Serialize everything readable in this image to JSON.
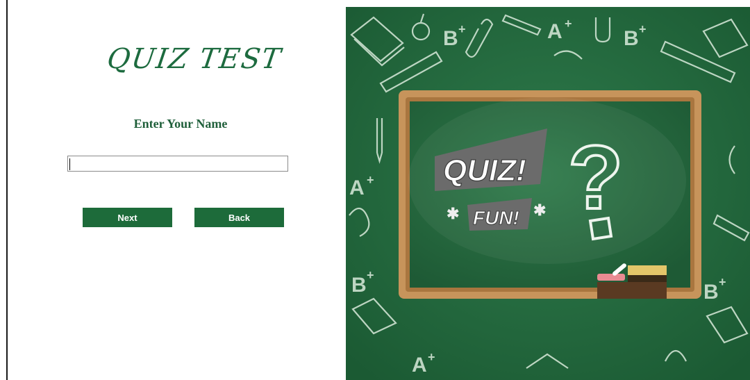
{
  "title": "QUIZ TEST",
  "form": {
    "name_label": "Enter Your Name",
    "name_value": "",
    "name_placeholder": ""
  },
  "buttons": {
    "next_label": "Next",
    "back_label": "Back"
  },
  "illustration": {
    "board_title": "QUIZ!",
    "board_subtitle": "FUN!",
    "question_mark": "?",
    "doodles": [
      "A+",
      "B+"
    ],
    "colors": {
      "brand_green": "#1d6b3a",
      "board_green": "#25633c",
      "frame_wood": "#c7945b"
    },
    "icons": [
      "book-icon",
      "pencil-icon",
      "ruler-icon",
      "apple-icon",
      "paperclip-icon",
      "eraser-icon",
      "chalk-icon"
    ]
  }
}
